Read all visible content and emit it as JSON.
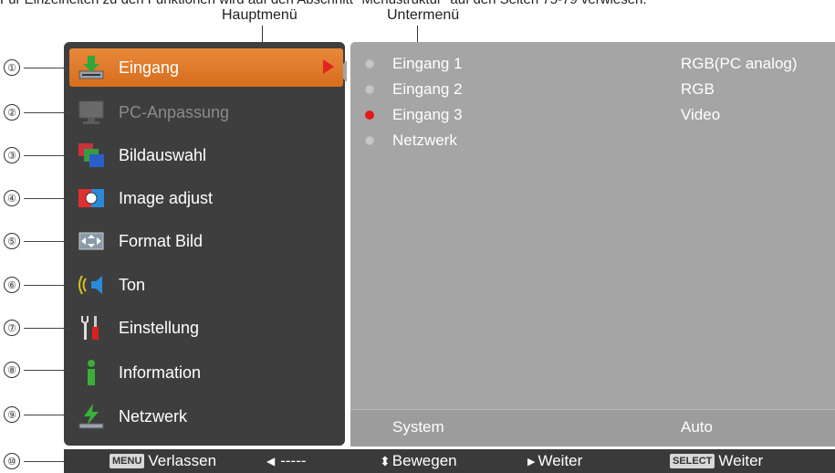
{
  "header": {
    "text": "Für Einzelheiten zu den Funktionen wird auf den Abschnitt \"Menüstruktur\" auf den Seiten 75-79 verwiesen.",
    "callout_main": "Hauptmenü",
    "callout_sub": "Untermenü"
  },
  "callout_numbers": [
    "①",
    "②",
    "③",
    "④",
    "⑤",
    "⑥",
    "⑦",
    "⑧",
    "⑨",
    "⑩"
  ],
  "main_menu": {
    "items": [
      {
        "label": "Eingang",
        "icon": "input-icon",
        "selected": true
      },
      {
        "label": "PC-Anpassung",
        "icon": "pc-adjust-icon",
        "disabled": true
      },
      {
        "label": "Bildauswahl",
        "icon": "image-select-icon"
      },
      {
        "label": "Image adjust",
        "icon": "image-adjust-icon"
      },
      {
        "label": "Format Bild",
        "icon": "screen-format-icon"
      },
      {
        "label": "Ton",
        "icon": "sound-icon"
      },
      {
        "label": "Einstellung",
        "icon": "settings-icon"
      },
      {
        "label": "Information",
        "icon": "information-icon"
      },
      {
        "label": "Netzwerk",
        "icon": "network-icon"
      }
    ]
  },
  "sub_menu": {
    "items": [
      {
        "label": "Eingang 1",
        "value": "RGB(PC analog)",
        "active": false
      },
      {
        "label": "Eingang 2",
        "value": "RGB",
        "active": false
      },
      {
        "label": "Eingang 3",
        "value": "Video",
        "active": true
      },
      {
        "label": "Netzwerk",
        "value": "",
        "active": false
      }
    ],
    "footer": {
      "label": "System",
      "value": "Auto"
    }
  },
  "bottom_bar": {
    "menu_key": "MENU",
    "exit_label": "Verlassen",
    "back_label": "-----",
    "move_label": "Bewegen",
    "next_label": "Weiter",
    "select_key": "SELECT",
    "select_label": "Weiter"
  },
  "colors": {
    "selected": "#e07b2b",
    "main_bg": "#3e3e3e",
    "sub_bg": "#a5a5a5",
    "active_dot": "#e01a1a"
  }
}
